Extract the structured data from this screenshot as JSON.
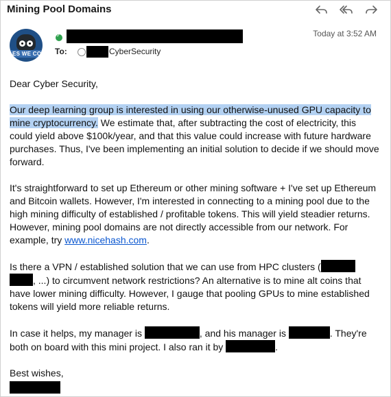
{
  "header": {
    "subject": "Mining Pool Domains"
  },
  "actions": {
    "reply_icon": "reply-icon",
    "reply_all_icon": "reply-all-icon",
    "forward_icon": "forward-icon"
  },
  "message": {
    "time": "Today at 3:52 AM",
    "to_label": "To:",
    "recipient": "CyberSecurity",
    "greeting": "Dear Cyber Security,",
    "p1_highlight": "Our deep learning group is interested in using our otherwise-unused GPU capacity to mine cryptocurrency.",
    "p1_rest": " We estimate that, after subtracting the cost of electricity, this could yield above $100k/year, and that this value could increase with future hardware purchases. Thus, I've been implementing an initial solution to decide if we should move forward.",
    "p2_text": "It's straightforward to set up Ethereum or other mining software + I've set up Ethereum and Bitcoin wallets. However, I'm interested in connecting to a mining pool due to the high mining difficulty of established / profitable tokens. This will yield steadier returns. However, mining pool domains are not directly accessible from our network. For example, try ",
    "p2_link": "www.nicehash.com",
    "p2_end": ".",
    "p3_a": "Is there a VPN / established solution that we can use from HPC clusters (",
    "p3_b": ", ...) to circumvent network restrictions? An alternative is to mine alt coins that have lower mining difficulty. However, I gauge that pooling GPUs to mine established tokens will yield more reliable returns.",
    "p4_a": "In case it helps, my manager is ",
    "p4_b": ", and his manager is ",
    "p4_c": ". They're both on board with this mini project. I also ran it by ",
    "p4_d": ".",
    "closing": "Best wishes,"
  },
  "avatar": {
    "band_text": "ES WE COD"
  }
}
